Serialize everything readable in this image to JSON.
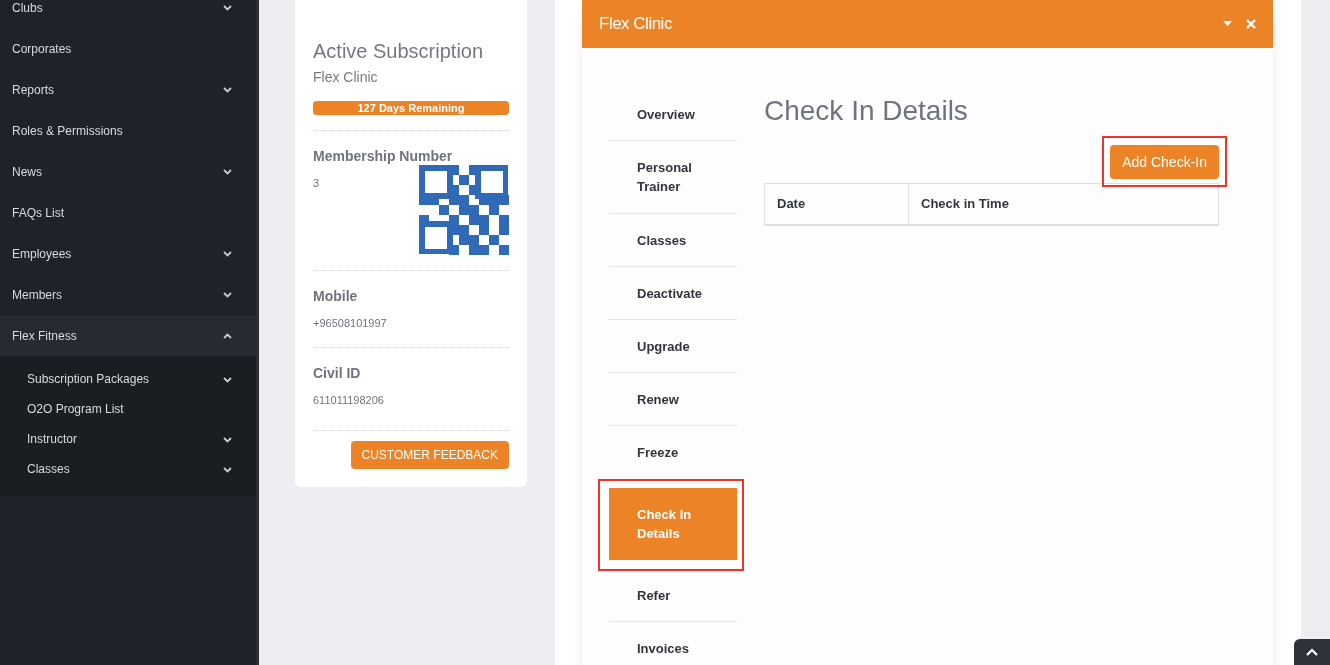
{
  "sidebar": {
    "items": [
      {
        "label": "Clubs",
        "has_submenu": true,
        "expanded": false
      },
      {
        "label": "Corporates",
        "has_submenu": false
      },
      {
        "label": "Reports",
        "has_submenu": true,
        "expanded": false
      },
      {
        "label": "Roles & Permissions",
        "has_submenu": false
      },
      {
        "label": "News",
        "has_submenu": true,
        "expanded": false
      },
      {
        "label": "FAQs List",
        "has_submenu": false
      },
      {
        "label": "Employees",
        "has_submenu": true,
        "expanded": false
      },
      {
        "label": "Members",
        "has_submenu": true,
        "expanded": false
      },
      {
        "label": "Flex Fitness",
        "has_submenu": true,
        "expanded": true,
        "children": [
          {
            "label": "Subscription Packages",
            "has_submenu": true
          },
          {
            "label": "O2O Program List",
            "has_submenu": false
          },
          {
            "label": "Instructor",
            "has_submenu": true
          },
          {
            "label": "Classes",
            "has_submenu": true
          }
        ]
      }
    ]
  },
  "profile": {
    "subscription_heading": "Active Subscription",
    "subscription_name": "Flex Clinic",
    "remaining": {
      "label": "127 Days Remaining",
      "level": 1
    },
    "fields": [
      {
        "label": "Membership Number",
        "value": "3",
        "qr": true
      },
      {
        "label": "Mobile",
        "value": "+96508101997",
        "qr": false
      },
      {
        "label": "Civil ID",
        "value": "611011198206",
        "qr": false
      }
    ],
    "feedback_button": "CUSTOMER FEEDBACK"
  },
  "modal": {
    "title": "Flex Clinic",
    "tabs": [
      {
        "label": "Overview",
        "selected": false,
        "highlighted": false
      },
      {
        "label": "Personal Trainer",
        "selected": false,
        "highlighted": false
      },
      {
        "label": "Classes",
        "selected": false,
        "highlighted": false
      },
      {
        "label": "Deactivate",
        "selected": false,
        "highlighted": false
      },
      {
        "label": "Upgrade",
        "selected": false,
        "highlighted": false
      },
      {
        "label": "Renew",
        "selected": false,
        "highlighted": false
      },
      {
        "label": "Freeze",
        "selected": false,
        "highlighted": false
      },
      {
        "label": "Check In Details",
        "selected": true,
        "highlighted": true
      },
      {
        "label": "Refer",
        "selected": false,
        "highlighted": false
      },
      {
        "label": "Invoices",
        "selected": false,
        "highlighted": false
      }
    ],
    "heading": "Check In Details",
    "add_button": {
      "label": "Add Check-In",
      "highlighted": true
    },
    "table": {
      "columns": [
        "Date",
        "Check in Time"
      ]
    }
  }
}
